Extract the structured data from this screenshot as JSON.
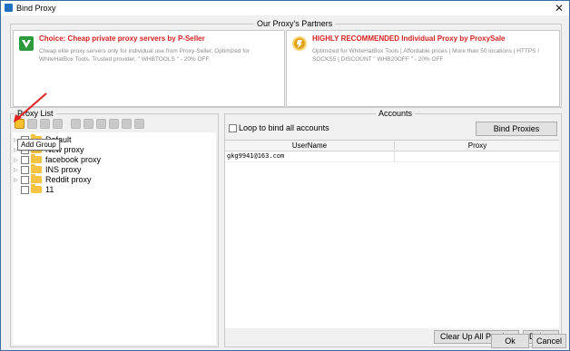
{
  "window": {
    "title": "Bind Proxy"
  },
  "partners": {
    "heading": "Our Proxy's Partners",
    "items": [
      {
        "title": "Choice: Cheap private proxy servers by P-Seller",
        "description": "Cheap elite proxy servers only for individual use from Proxy-Seller. Optimized for WhiteHatBox Tools. Trusted provider. \" WHBTOOLS \" - 20% OFF",
        "logo": "p-seller-logo"
      },
      {
        "title": "HIGHLY RECOMMENDED Individual Proxy by ProxySale",
        "description": "Optimized for WhiteHatBox Tools | Affordable prices | More than 50 locations | HTTPS / SOCKS5 | DISCOUNT \" WHB20OFF \" - 20% OFF",
        "logo": "proxysale-logo"
      }
    ]
  },
  "proxy_list": {
    "heading": "Proxy List",
    "tooltip": "Add Group",
    "toolbar": [
      "add-group-icon",
      "add-folder-icon",
      "edit-icon",
      "copy-icon",
      "import-icon",
      "export-icon",
      "check-icon",
      "delete-icon",
      "refresh-icon",
      "settings-icon"
    ],
    "groups": [
      "Default",
      "New proxy",
      "facebook proxy",
      "INS proxy",
      "Reddit proxy",
      "11"
    ]
  },
  "accounts": {
    "heading": "Accounts",
    "loop_label": "Loop to bind all accounts",
    "bind_button": "Bind Proxies",
    "columns": [
      "UserName",
      "Proxy"
    ],
    "rows": [
      {
        "username": "gkg9941@163.com",
        "proxy": ""
      }
    ],
    "clear_button": "Clear Up All Proxies",
    "delete_button": "Delete"
  },
  "footer": {
    "ok": "Ok",
    "cancel": "Cancel"
  },
  "colors": {
    "accent_red": "#d62020",
    "folder": "#f6c243",
    "p_seller_green": "#2e9a3e",
    "proxysale_gold": "#e0a21a"
  }
}
